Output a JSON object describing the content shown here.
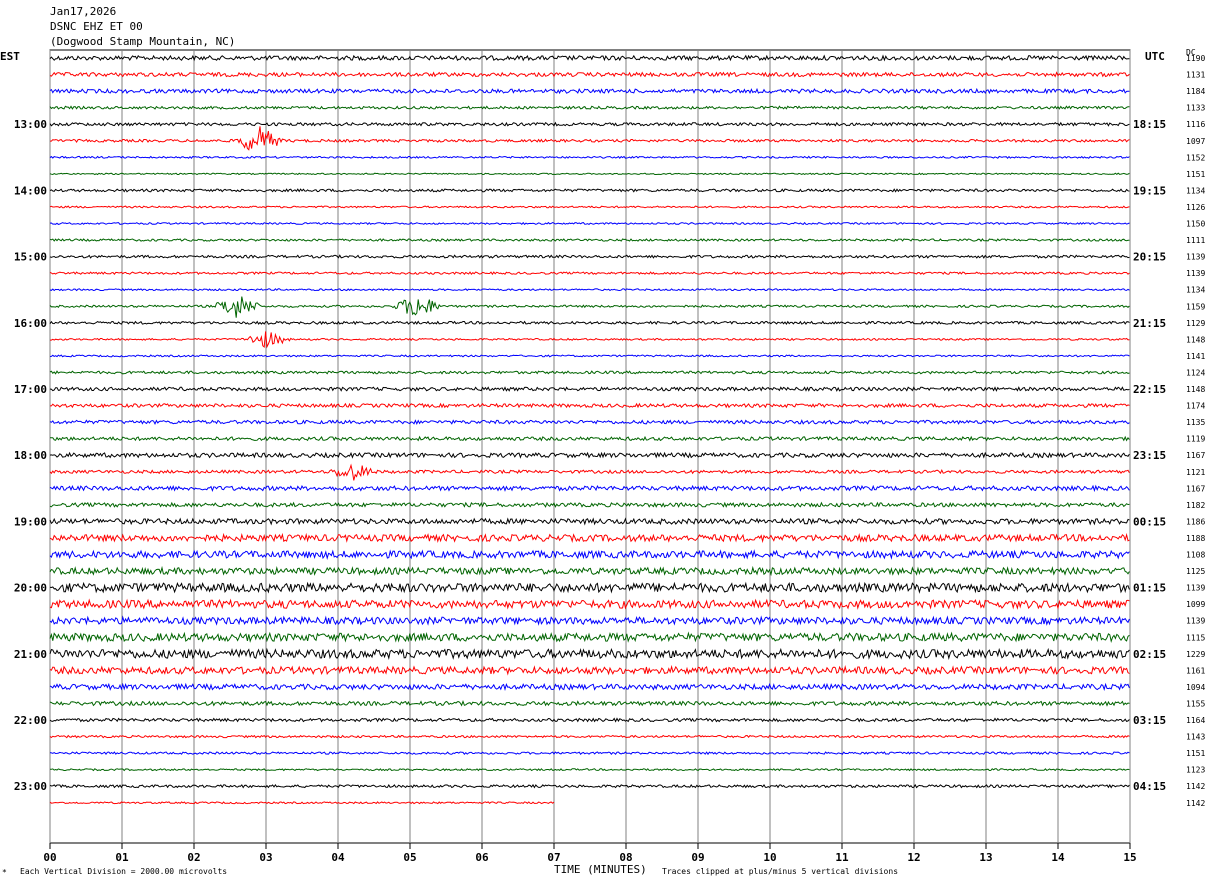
{
  "header": {
    "date": "Jan17,2026",
    "station": "DSNC EHZ ET 00",
    "location": "(Dogwood Stamp Mountain, NC)"
  },
  "corner_labels": {
    "left": "EST",
    "right": "UTC",
    "dc": "DC"
  },
  "footer": {
    "scale": "Each Vertical Division = 2000.00 microvolts",
    "xlabel": "TIME (MINUTES)",
    "clip_note": "Traces clipped at plus/minus 5 vertical divisions",
    "mark": "*"
  },
  "colors": {
    "black": "#000000",
    "red": "#ff0000",
    "blue": "#0000ff",
    "green": "#006400",
    "grid": "#808080"
  },
  "chart_data": {
    "type": "line",
    "title": "DSNC EHZ ET 00",
    "xlabel": "TIME (MINUTES)",
    "xlim": [
      0,
      15
    ],
    "x_ticks": [
      "00",
      "01",
      "02",
      "03",
      "04",
      "05",
      "06",
      "07",
      "08",
      "09",
      "10",
      "11",
      "12",
      "13",
      "14",
      "15"
    ],
    "left_hour_labels": [
      "13:00",
      "14:00",
      "15:00",
      "16:00",
      "17:00",
      "18:00",
      "19:00",
      "20:00",
      "21:00",
      "22:00",
      "23:00"
    ],
    "right_hour_labels": [
      "18:15",
      "19:15",
      "20:15",
      "21:15",
      "22:15",
      "23:15",
      "00:15",
      "01:15",
      "02:15",
      "03:15",
      "04:15"
    ],
    "trace_color_cycle": [
      "black",
      "red",
      "blue",
      "green"
    ],
    "dc_offsets": [
      1190,
      1131,
      1184,
      1133,
      1116,
      1097,
      1152,
      1151,
      1134,
      1126,
      1150,
      1111,
      1139,
      1139,
      1134,
      1159,
      1129,
      1148,
      1141,
      1124,
      1148,
      1174,
      1135,
      1119,
      1167,
      1121,
      1167,
      1182,
      1186,
      1188,
      1108,
      1125,
      1139,
      1099,
      1139,
      1115,
      1229,
      1161,
      1094,
      1155,
      1164,
      1143,
      1151,
      1123,
      1142,
      1142
    ],
    "trace_amplitudes": [
      1.0,
      0.9,
      0.9,
      0.6,
      0.7,
      0.6,
      0.4,
      0.3,
      0.6,
      0.4,
      0.4,
      0.5,
      0.6,
      0.5,
      0.4,
      0.5,
      0.6,
      0.4,
      0.4,
      0.6,
      0.8,
      0.8,
      0.8,
      0.8,
      1.0,
      0.7,
      1.0,
      0.9,
      1.2,
      1.5,
      1.6,
      1.5,
      2.0,
      1.8,
      1.6,
      1.8,
      2.0,
      1.6,
      1.2,
      0.9,
      0.7,
      0.5,
      0.5,
      0.4,
      0.6,
      0.4
    ],
    "last_trace_end_minute": 7.0,
    "events": [
      {
        "trace": 5,
        "minute": 2.9,
        "amplitude": 3.5
      },
      {
        "trace": 15,
        "minute": 2.6,
        "amplitude": 3.0
      },
      {
        "trace": 15,
        "minute": 5.1,
        "amplitude": 3.0
      },
      {
        "trace": 17,
        "minute": 3.0,
        "amplitude": 2.0
      },
      {
        "trace": 25,
        "minute": 4.2,
        "amplitude": 2.0
      }
    ]
  }
}
